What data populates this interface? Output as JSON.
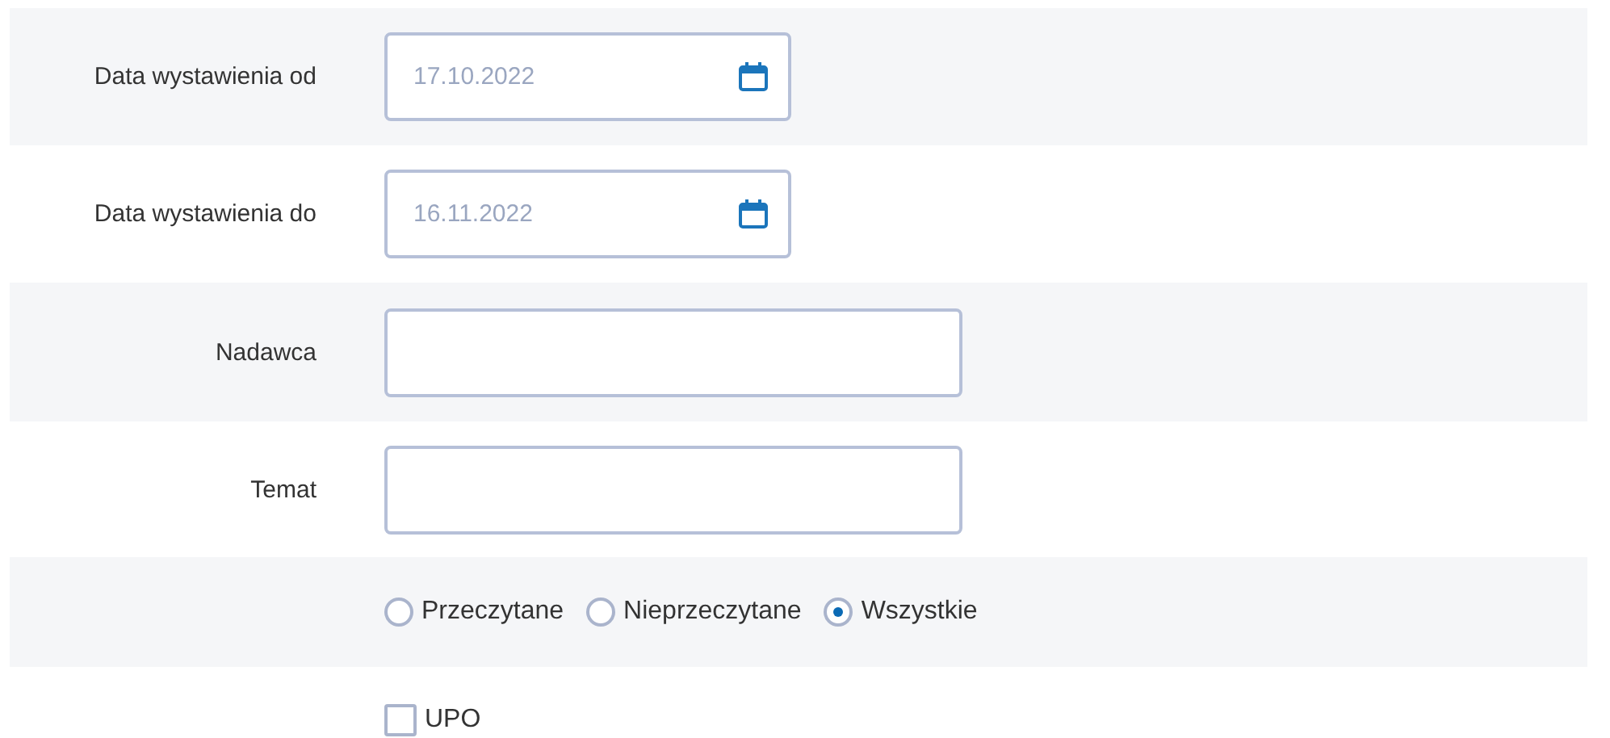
{
  "rows": [
    {
      "kind": "date",
      "label": "Data wystawienia od",
      "value": "17.10.2022"
    },
    {
      "kind": "date",
      "label": "Data wystawienia do",
      "value": "16.11.2022"
    },
    {
      "kind": "text",
      "label": "Nadawca"
    },
    {
      "kind": "text",
      "label": "Temat"
    },
    {
      "kind": "radio",
      "options": [
        {
          "label": "Przeczytane",
          "selected": false
        },
        {
          "label": "Nieprzeczytane",
          "selected": false
        },
        {
          "label": "Wszystkie",
          "selected": true
        }
      ]
    },
    {
      "kind": "checkbox",
      "label": "UPO",
      "checked": false
    }
  ]
}
